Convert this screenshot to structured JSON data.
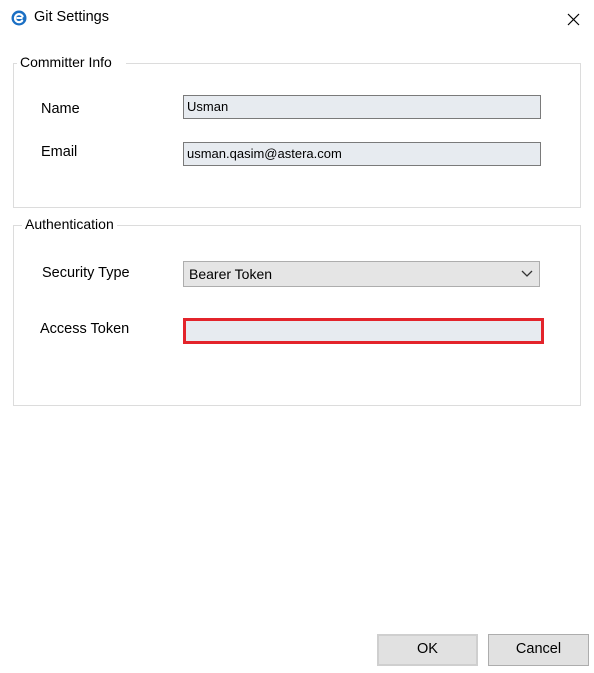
{
  "window": {
    "title": "Git Settings",
    "app_icon": "astera-e-icon",
    "close_icon": "close-icon"
  },
  "committer_info": {
    "legend": "Committer Info",
    "name_label": "Name",
    "name_value": "Usman",
    "email_label": "Email",
    "email_value": "usman.qasim@astera.com"
  },
  "authentication": {
    "legend": "Authentication",
    "security_type_label": "Security Type",
    "security_type_value": "Bearer Token",
    "access_token_label": "Access Token",
    "access_token_value": ""
  },
  "buttons": {
    "ok_label": "OK",
    "cancel_label": "Cancel"
  },
  "colors": {
    "highlight": "#e3242b",
    "app_icon": "#1a6fc4",
    "textbox_bg": "#e7ebf0"
  }
}
